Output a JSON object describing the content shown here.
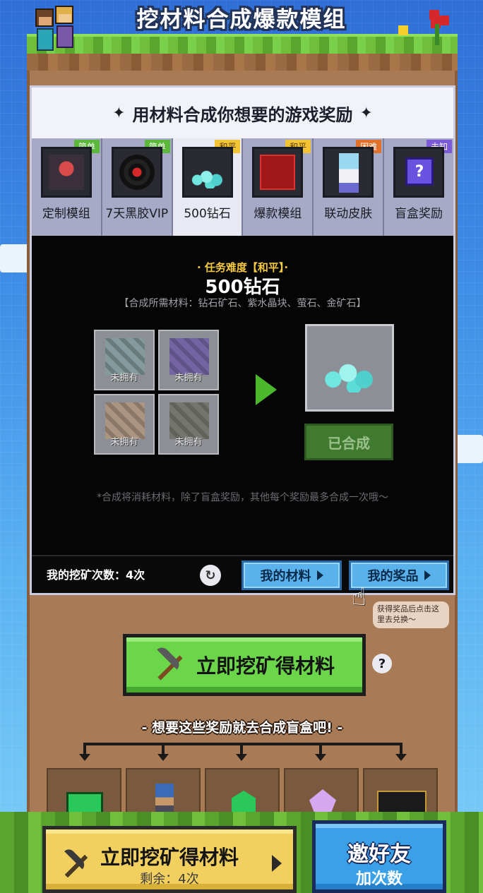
{
  "header": {
    "title": "挖材料合成爆款模组"
  },
  "subtitle": "用材料合成你想要的游戏奖励",
  "tabs": [
    {
      "label": "定制模组",
      "badge": "简单",
      "level": "easy",
      "icon": "custom-mod-icon"
    },
    {
      "label": "7天黑胶VIP",
      "badge": "简单",
      "level": "easy",
      "icon": "vinyl-vip-icon"
    },
    {
      "label": "500钻石",
      "badge": "和平",
      "level": "peace",
      "icon": "diamond-icon",
      "active": true
    },
    {
      "label": "爆款模组",
      "badge": "和平",
      "level": "peace",
      "icon": "hot-mod-icon"
    },
    {
      "label": "联动皮肤",
      "badge": "困难",
      "level": "hard",
      "icon": "collab-skin-icon"
    },
    {
      "label": "盲盒奖励",
      "badge": "未知",
      "level": "unknown",
      "icon": "mystery-box-icon"
    }
  ],
  "detail": {
    "difficulty": "· 任务难度【和平】·",
    "reward_name": "500钻石",
    "materials_needed": "【合成所需材料：钻石矿石、紫水晶块、萤石、金矿石】",
    "materials": [
      {
        "name": "diamond-ore",
        "caption": "未拥有",
        "color": "#7fa0a0"
      },
      {
        "name": "amethyst-block",
        "caption": "未拥有",
        "color": "#6a52a8"
      },
      {
        "name": "glowstone",
        "caption": "未拥有",
        "color": "#b89878"
      },
      {
        "name": "gold-ore",
        "caption": "未拥有",
        "color": "#6a6a5a"
      }
    ],
    "synth_button": "已合成",
    "note": "*合成将消耗材料，除了盲盒奖励，其他每个奖励最多合成一次哦～"
  },
  "status_bar": {
    "mine_count": "我的挖矿次数：4次",
    "my_materials": "我的材料",
    "my_prizes": "我的奖品",
    "tooltip": "获得奖品后点击这里去兑换～"
  },
  "cta": {
    "label": "立即挖矿得材料",
    "help": "?"
  },
  "blindbox_title": "- 想要这些奖励就去合成盲盒吧! -",
  "prizes": [
    "ticket-icon",
    "character-icon",
    "emerald-icon",
    "crystal-icon",
    "card-icon"
  ],
  "footer": {
    "mine_label": "立即挖矿得材料",
    "remaining": "剩余：4次",
    "invite_line1": "邀好友",
    "invite_line2": "加次数"
  }
}
